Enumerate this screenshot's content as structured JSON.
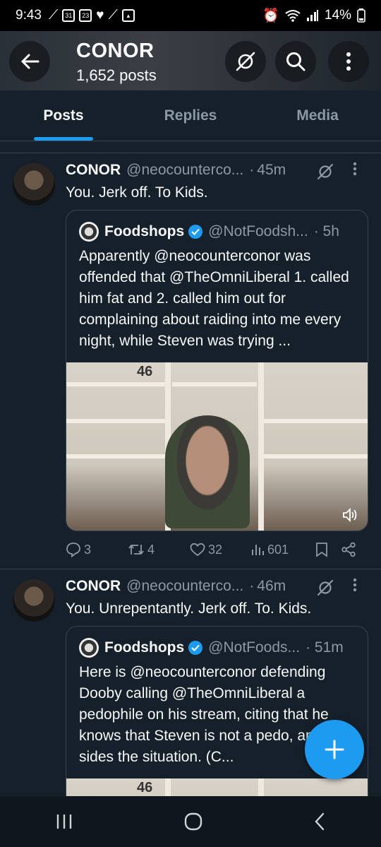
{
  "status": {
    "time": "9:43",
    "battery": "14%",
    "left_icons": [
      "sneaker-icon",
      "calendar-31-icon",
      "calendar-23-icon",
      "heart-icon",
      "sneaker-icon",
      "gallery-icon"
    ]
  },
  "header": {
    "title": "CONOR",
    "subtitle": "1,652 posts"
  },
  "tabs": [
    {
      "label": "Posts",
      "active": true
    },
    {
      "label": "Replies",
      "active": false
    },
    {
      "label": "Media",
      "active": false
    }
  ],
  "posts": [
    {
      "name": "CONOR",
      "handle": "@neocounterco...",
      "time": "45m",
      "text": "You. Jerk off. To Kids.",
      "quote": {
        "name": "Foodshops",
        "handle": "@NotFoodsh...",
        "time": "5h",
        "text": "Apparently @neocounterconor was offended that @TheOmniLiberal 1. called him fat and 2. called him out for complaining about raiding into me every night, while Steven was trying ..."
      },
      "stats": {
        "replies": "3",
        "reposts": "4",
        "likes": "32",
        "views": "601"
      }
    },
    {
      "name": "CONOR",
      "handle": "@neocounterco...",
      "time": "46m",
      "text": "You. Unrepentantly. Jerk off. To. Kids.",
      "quote": {
        "name": "Foodshops",
        "handle": "@NotFoods...",
        "time": "51m",
        "text": "Here is @neocounterconor defending Dooby calling @TheOmniLiberal a pedophile on his stream, citing that he knows that Steven is not a pedo, and both sides the situation. (C..."
      }
    }
  ],
  "media_overlay_number": "46",
  "colors": {
    "accent": "#1d9bf0",
    "background": "#15202b",
    "muted": "#8b98a5"
  }
}
